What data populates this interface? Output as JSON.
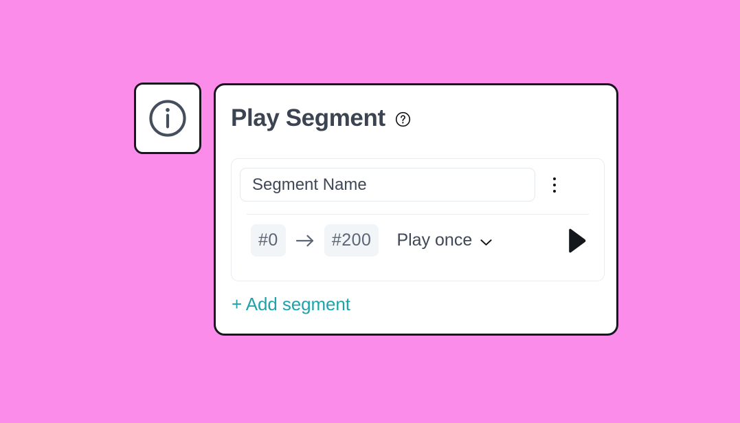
{
  "theme": {
    "background_color": "#fb8ce9",
    "card_background": "#ffffff",
    "card_border": "#15181d",
    "title_color": "#3c4451",
    "accent_link_color": "#1fa3ab",
    "pill_background": "#f1f5f8",
    "pill_text_color": "#5b6575",
    "muted_border": "#e8ecef",
    "play_icon_color": "#14171c"
  },
  "info_button": {
    "icon": "info-circle-icon",
    "label": ""
  },
  "card": {
    "title": "Play Segment",
    "help_icon": "question-circle-icon",
    "segment": {
      "name_input": {
        "value": "",
        "placeholder": "Segment Name"
      },
      "menu_icon": "kebab-menu-icon",
      "start_frame": "#0",
      "arrow_icon": "arrow-right-icon",
      "end_frame": "#200",
      "loop_mode": {
        "selected": "Play once",
        "chevron_icon": "chevron-down-icon",
        "options": [
          "Play once"
        ]
      },
      "play_icon": "play-icon"
    },
    "add_segment_label": "+ Add segment"
  }
}
